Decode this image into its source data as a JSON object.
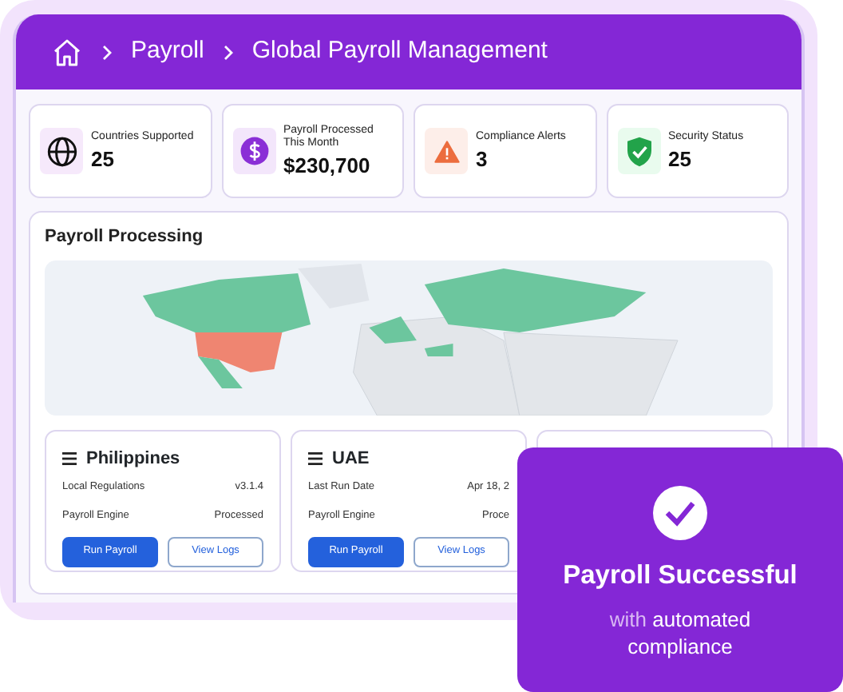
{
  "breadcrumb": [
    {
      "kind": "home"
    },
    {
      "kind": "link",
      "label": "Payroll"
    },
    {
      "kind": "current",
      "label": "Global Payroll Management"
    }
  ],
  "stats": [
    {
      "kind": "globe",
      "label": "Countries Supported",
      "value": "25"
    },
    {
      "kind": "dollar",
      "label": "Payroll Processed This Month",
      "value": "$230,700"
    },
    {
      "kind": "alert",
      "label": "Compliance Alerts",
      "value": "3"
    },
    {
      "kind": "shield",
      "label": "Security Status",
      "value": "25"
    }
  ],
  "processing": {
    "title": "Payroll Processing",
    "countries": [
      {
        "kind": "country",
        "name": "Philippines",
        "rows": [
          {
            "label": "Local Regulations",
            "value": "v3.1.4"
          },
          {
            "label": "Payroll Engine",
            "value": "Processed"
          }
        ],
        "buttons": [
          {
            "kind": "primary",
            "label": "Run Payroll"
          },
          {
            "kind": "outline",
            "label": "View Logs"
          }
        ]
      },
      {
        "kind": "country",
        "name": "UAE",
        "rows": [
          {
            "label": "Last Run Date",
            "value": "Apr 18, 2"
          },
          {
            "label": "Payroll Engine",
            "value": "Proce"
          }
        ],
        "buttons": [
          {
            "kind": "primary",
            "label": "Run Payroll"
          },
          {
            "kind": "outline",
            "label": "View Logs"
          }
        ]
      },
      {
        "kind": "blank"
      }
    ]
  },
  "toast": {
    "title": "Payroll Successful",
    "subtitle_muted": "with",
    "subtitle": "automated compliance"
  }
}
